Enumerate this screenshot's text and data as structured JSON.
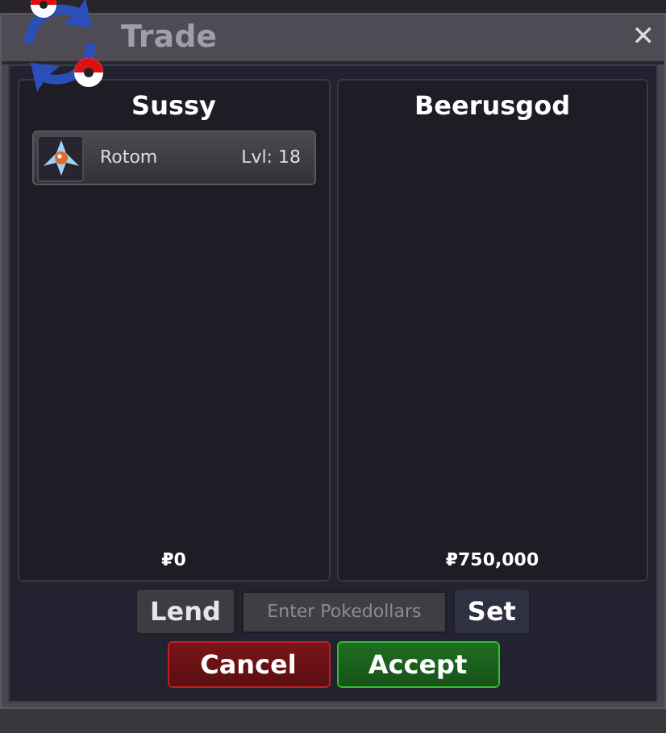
{
  "window": {
    "title": "Trade",
    "close": "✕"
  },
  "panels": [
    {
      "player": "Sussy",
      "items": [
        {
          "name": "Rotom",
          "level": "Lvl: 18"
        }
      ],
      "money": "₽0"
    },
    {
      "player": "Beerusgod",
      "money": "₽750,000"
    }
  ],
  "lend_button": "Lend",
  "money_field": {
    "placeholder": "Enter Pokedollars"
  },
  "set_button": "Set",
  "buttons": [
    {
      "label": "Cancel",
      "kind": "cancel"
    },
    {
      "label": "Accept",
      "kind": "accept"
    }
  ]
}
